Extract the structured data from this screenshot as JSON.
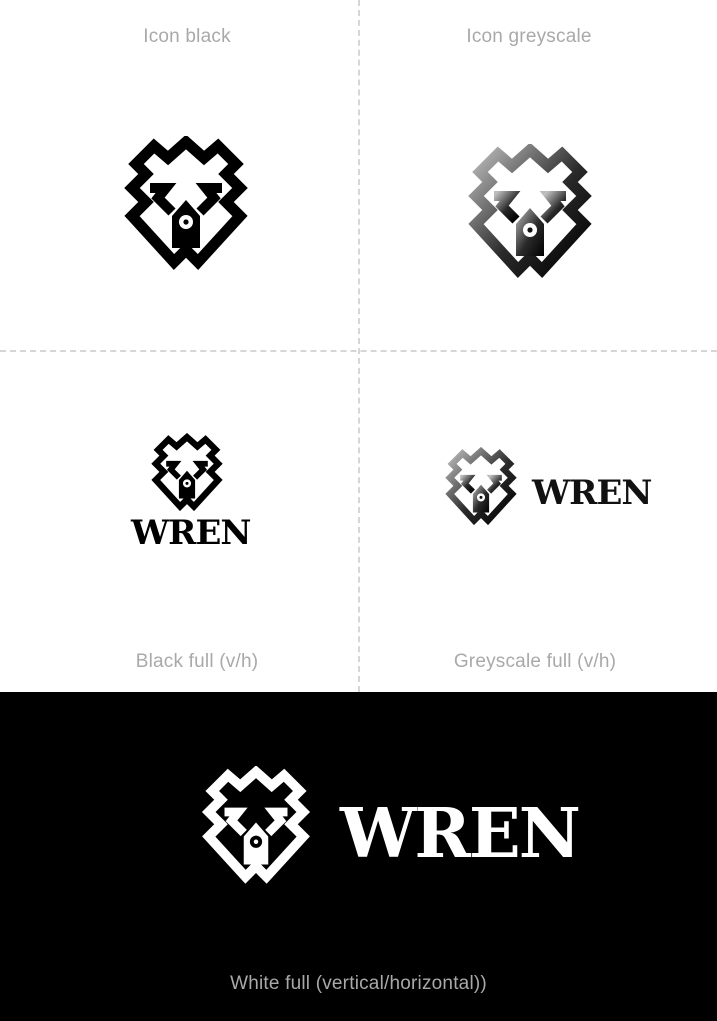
{
  "brand": {
    "wordmark": "WREN",
    "icon": "wren-monogram-icon",
    "colors": {
      "black": "#000000",
      "white": "#ffffff",
      "grey_light": "#bdbdbd",
      "grey_dark": "#111111",
      "caption": "#a9a9a9",
      "divider": "#d6d6d6"
    }
  },
  "panels": {
    "icon_black": {
      "caption": "Icon black"
    },
    "icon_greyscale": {
      "caption": "Icon greyscale"
    },
    "black_full": {
      "caption": "Black full (v/h)",
      "wordmark": "WREN"
    },
    "greyscale_full": {
      "caption": "Greyscale full (v/h)",
      "wordmark": "WREN"
    },
    "white_full": {
      "caption": "White full (vertical/horizontal))",
      "wordmark": "WREN"
    }
  }
}
